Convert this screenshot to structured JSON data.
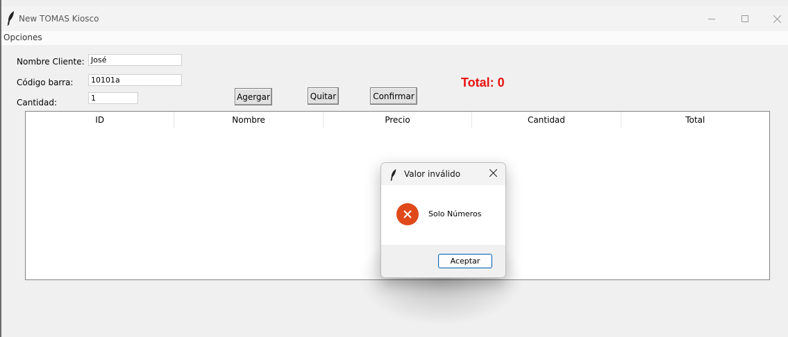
{
  "window": {
    "title": "New TOMAS Kiosco",
    "icon": "feather-icon"
  },
  "menu": {
    "items": [
      "Opciones"
    ]
  },
  "form": {
    "nombre_label": "Nombre Cliente:",
    "nombre_value": "José",
    "codigo_label": "Código barra:",
    "codigo_value": "10101a",
    "cantidad_label": "Cantidad:",
    "cantidad_value": "1"
  },
  "buttons": {
    "agregar": "Agergar",
    "quitar": "Quitar",
    "confirmar": "Confirmar"
  },
  "total": {
    "text": "Total: 0",
    "color": "#e8120f"
  },
  "table": {
    "columns": [
      "ID",
      "Nombre",
      "Precio",
      "Cantidad",
      "Total"
    ],
    "rows": []
  },
  "dialog": {
    "title": "Valor inválido",
    "message": "Solo Números",
    "icon": "error-icon",
    "icon_color": "#e0491a",
    "ok_label": "Aceptar"
  }
}
